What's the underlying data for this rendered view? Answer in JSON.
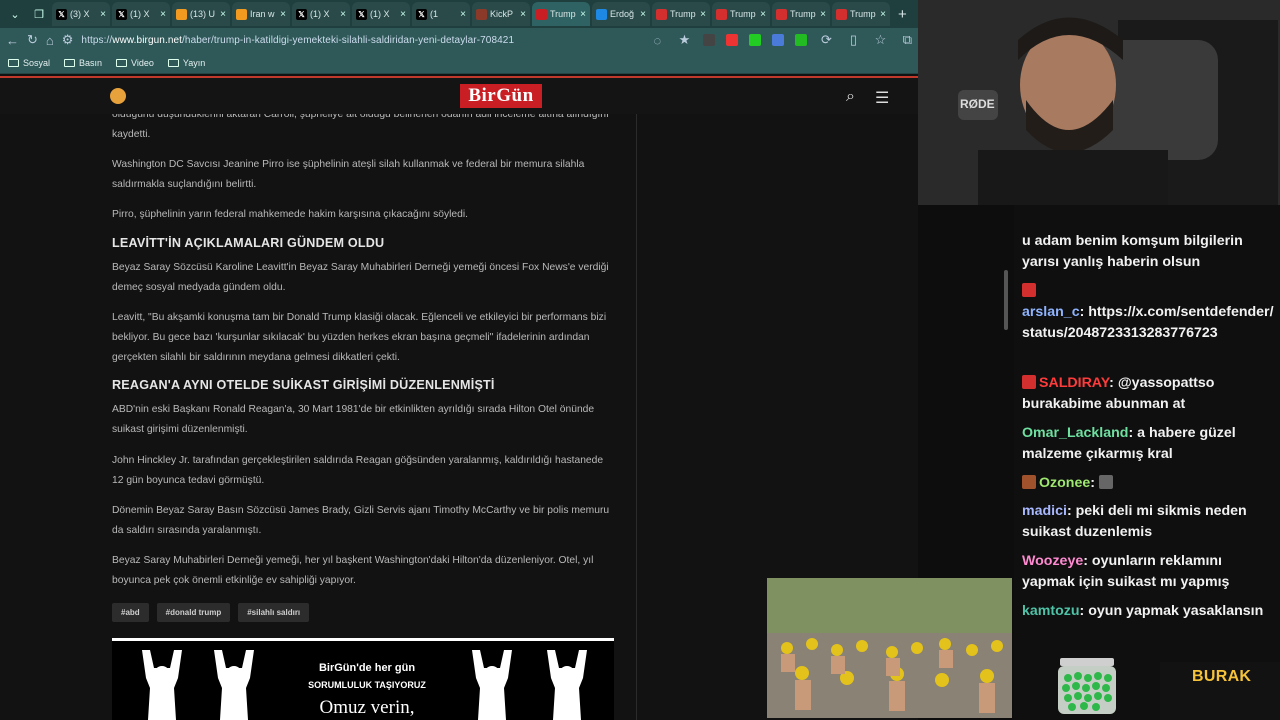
{
  "browser": {
    "tabs": [
      {
        "title": "(3) X",
        "icon": "x-logo",
        "color": "#000000"
      },
      {
        "title": "(1) X",
        "icon": "x-logo",
        "color": "#000000"
      },
      {
        "title": "(13) U",
        "icon": "orange-app-icon",
        "color": "#f29a1f"
      },
      {
        "title": "Iran w",
        "icon": "orange-app-icon",
        "color": "#f29a1f"
      },
      {
        "title": "(1) X",
        "icon": "x-logo",
        "color": "#000000"
      },
      {
        "title": "(1) X",
        "icon": "x-logo",
        "color": "#000000"
      },
      {
        "title": "(1",
        "icon": "x-logo",
        "color": "#000000"
      },
      {
        "title": "KickP",
        "icon": "kick-icon",
        "color": "#8b3a2a"
      },
      {
        "title": "Trump",
        "icon": "birgun-icon",
        "color": "#c81e24",
        "active": true
      },
      {
        "title": "Erdoğ",
        "icon": "news-icon",
        "color": "#1e88e5"
      },
      {
        "title": "Trump",
        "icon": "news-icon",
        "color": "#d32f2f"
      },
      {
        "title": "Trump",
        "icon": "news-icon",
        "color": "#d32f2f"
      },
      {
        "title": "Trump",
        "icon": "news-icon",
        "color": "#d32f2f"
      },
      {
        "title": "Trump",
        "icon": "news-icon",
        "color": "#d32f2f"
      }
    ],
    "url_prefix": "https://",
    "url_domain": "www.birgun.net",
    "url_path": "/haber/trump-in-katildigi-yemekteki-silahli-saldiridan-yeni-detaylar-708421",
    "bookmarks": [
      "Sosyal",
      "Basın",
      "Video",
      "Yayın"
    ]
  },
  "site": {
    "logo": "BirGün"
  },
  "article": {
    "p1": "olduğunu düşündüklerini aktaran Carroll, şüpheliye ait olduğu belirlenen odanın adli inceleme altına alındığını kaydetti.",
    "p2": "Washington DC Savcısı Jeanine Pirro ise şüphelinin ateşli silah kullanmak ve federal bir memura silahla saldırmakla suçlandığını belirtti.",
    "p3": "Pirro, şüphelinin yarın federal mahkemede hakim karşısına çıkacağını söyledi.",
    "h1": "LEAVİTT'İN AÇIKLAMALARI GÜNDEM OLDU",
    "p4": "Beyaz Saray Sözcüsü Karoline Leavitt'in Beyaz Saray Muhabirleri Derneği yemeği öncesi Fox News'e verdiği demeç sosyal medyada gündem oldu.",
    "p5": "Leavitt, \"Bu akşamki konuşma tam bir Donald Trump klasiği olacak. Eğlenceli ve etkileyici bir performans bizi bekliyor. Bu gece bazı 'kurşunlar sıkılacak' bu yüzden herkes ekran başına geçmeli\" ifadelerinin ardından gerçekten silahlı bir saldırının meydana gelmesi dikkatleri çekti.",
    "h2": "REAGAN'A AYNI OTELDE SUİKAST GİRİŞİMİ DÜZENLENMİŞTİ",
    "p6": "ABD'nin eski Başkanı Ronald Reagan'a, 30 Mart 1981'de bir etkinlikten ayrıldığı sırada Hilton Otel önünde suikast girişimi düzenlenmişti.",
    "p7": "John Hinckley Jr. tarafından gerçekleştirilen saldırıda Reagan göğsünden yaralanmış, kaldırıldığı hastanede 12 gün boyunca tedavi görmüştü.",
    "p8": "Dönemin Beyaz Saray Basın Sözcüsü James Brady, Gizli Servis ajanı Timothy McCarthy ve bir polis memuru da saldırı sırasında yaralanmıştı.",
    "p9": "Beyaz Saray Muhabirleri Derneği yemeği, her yıl başkent Washington'daki Hilton'da düzenleniyor. Otel, yıl boyunca pek çok önemli etkinliğe ev sahipliği yapıyor.",
    "tags": [
      "#abd",
      "#donald trump",
      "#silahlı saldırı"
    ],
    "banner_line1": "BirGün'de her gün",
    "banner_line2": "SORUMLULUK TAŞIYORUZ",
    "banner_line3": "Omuz verin,"
  },
  "chat": {
    "messages": [
      {
        "user": "",
        "text": "u adam benim komşum bilgilerin yarısı yanlış haberin olsun",
        "user_color": "#ffffff"
      },
      {
        "user": "arslan_c",
        "text": "https://x.com/sentdefender/status/2048723313283776723",
        "user_color": "#8fb4ff"
      },
      {
        "user": "SALDIRAY",
        "text": "@yassopattso burakabime abunman at",
        "user_color": "#ff3b3b"
      },
      {
        "user": "Omar_Lackland",
        "text": "a habere güzel malzeme çıkarmış kral",
        "user_color": "#6ee0a0"
      },
      {
        "user": "Ozonee",
        "text": "",
        "user_color": "#9fe870"
      },
      {
        "user": "madici",
        "text": "peki deli mi sikmis neden suikast duzenlemis",
        "user_color": "#a8b8ff"
      },
      {
        "user": "Woozeye",
        "text": "oyunların reklamını yapmak için suikast mı yapmış",
        "user_color": "#ff8ad1"
      },
      {
        "user": "kamtozu",
        "text": "oyun yapmak yasaklansın",
        "user_color": "#4fc3a7"
      }
    ]
  },
  "overlay": {
    "name": "BURAK",
    "mic_label": "RØDE"
  }
}
